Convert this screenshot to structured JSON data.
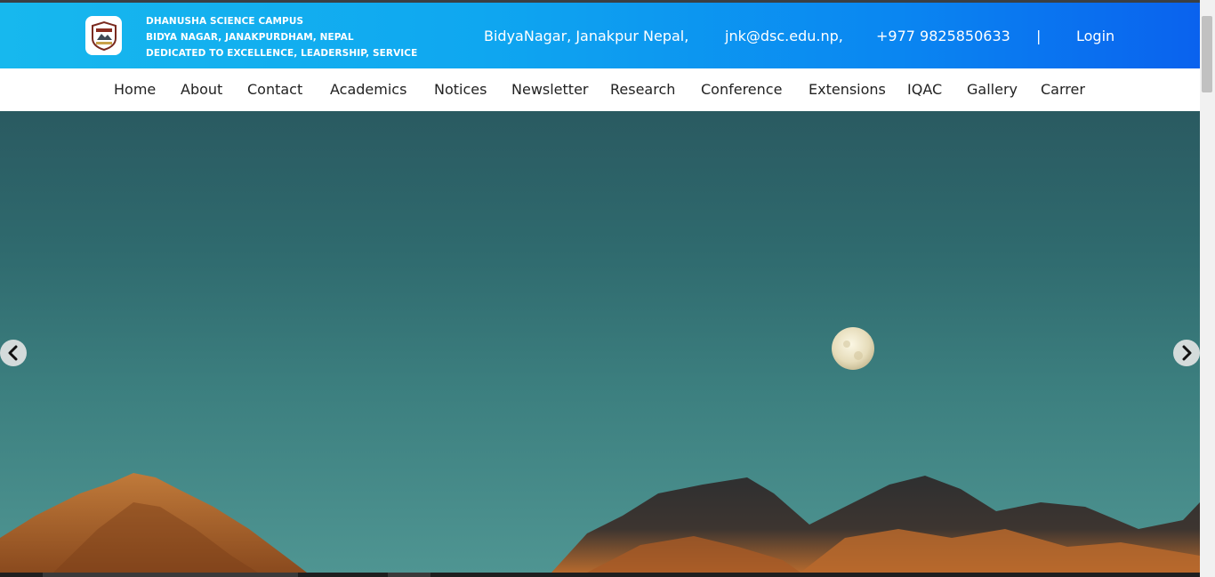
{
  "header": {
    "campus_lines": [
      "DHANUSHA SCIENCE CAMPUS",
      "BIDYA NAGAR, JANAKPURDHAM, NEPAL",
      "DEDICATED TO EXCELLENCE, LEADERSHIP, SERVICE"
    ],
    "address": "BidyaNagar, Janakpur Nepal,",
    "email": "jnk@dsc.edu.np,",
    "phone": "+977 9825850633",
    "divider": "|",
    "login": "Login",
    "gradient_colors": [
      "#17b8ee",
      "#0a62ee"
    ]
  },
  "nav": {
    "items": [
      "Home",
      "About",
      "Contact",
      "Academics",
      "Notices",
      "Newsletter",
      "Research",
      "Conference",
      "Extensions",
      "IQAC",
      "Gallery",
      "Carrer"
    ]
  },
  "carousel": {
    "prev_icon": "chevron-left-icon",
    "next_icon": "chevron-right-icon"
  }
}
